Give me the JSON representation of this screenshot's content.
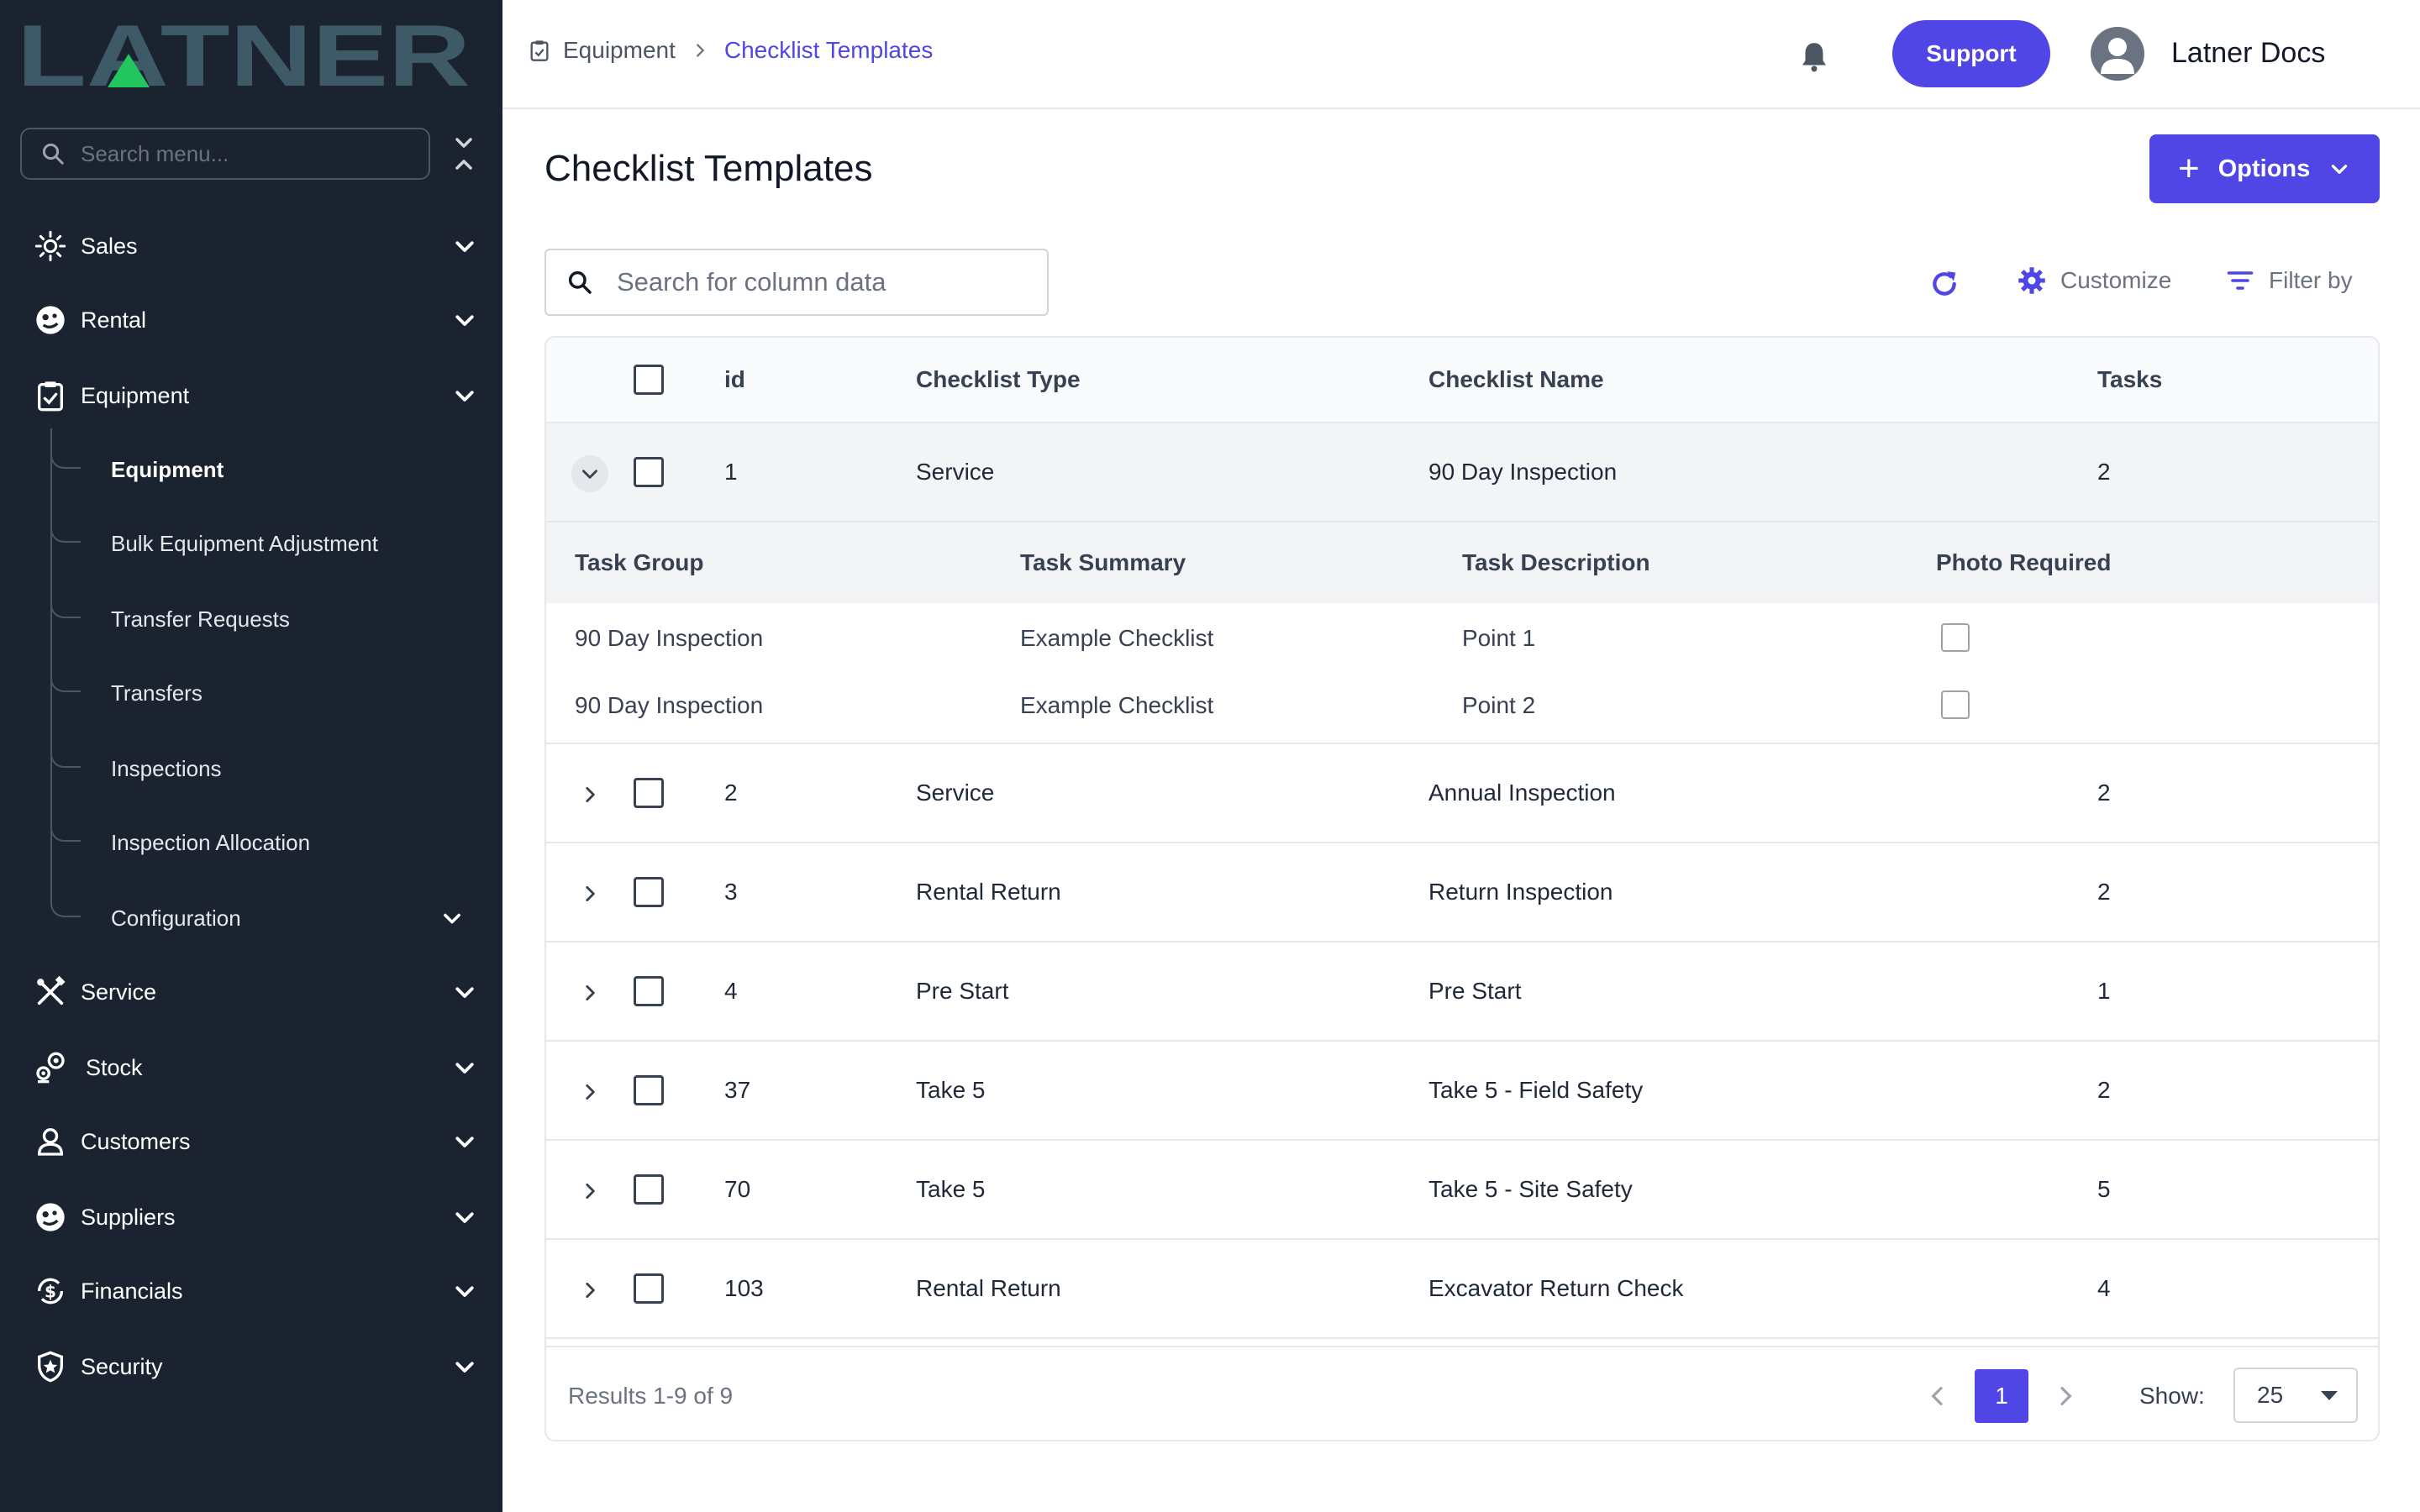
{
  "brand": {
    "logo_text": "LATNER",
    "logo_color": "#3d5a66",
    "accent_triangle": "#22c55e"
  },
  "colors": {
    "sidebar_bg": "#1b2331",
    "accent": "#4f46e5"
  },
  "sidebar": {
    "search_placeholder": "Search menu...",
    "items": [
      {
        "label": "Sales",
        "icon": "sales-icon"
      },
      {
        "label": "Rental",
        "icon": "rental-icon"
      },
      {
        "label": "Equipment",
        "icon": "clipboard-icon",
        "expanded": true
      },
      {
        "label": "Service",
        "icon": "tools-icon"
      },
      {
        "label": "Stock",
        "icon": "stock-icon"
      },
      {
        "label": "Customers",
        "icon": "person-icon"
      },
      {
        "label": "Suppliers",
        "icon": "supplier-icon"
      },
      {
        "label": "Financials",
        "icon": "dollar-cycle-icon"
      },
      {
        "label": "Security",
        "icon": "shield-icon"
      }
    ],
    "equipment_subitems": [
      {
        "label": "Equipment",
        "active": true
      },
      {
        "label": "Bulk Equipment Adjustment"
      },
      {
        "label": "Transfer Requests"
      },
      {
        "label": "Transfers"
      },
      {
        "label": "Inspections"
      },
      {
        "label": "Inspection Allocation"
      },
      {
        "label": "Configuration",
        "has_children": true
      }
    ]
  },
  "topbar": {
    "breadcrumb": [
      "Equipment",
      "Checklist Templates"
    ],
    "support_label": "Support",
    "user_name": "Latner Docs"
  },
  "page": {
    "title": "Checklist Templates",
    "options_label": "Options",
    "search_placeholder": "Search for column data",
    "customize_label": "Customize",
    "filter_label": "Filter by"
  },
  "table": {
    "columns": [
      "id",
      "Checklist Type",
      "Checklist Name",
      "Tasks"
    ],
    "rows": [
      {
        "id": "1",
        "type": "Service",
        "name": "90 Day Inspection",
        "tasks": "2",
        "expanded": true
      },
      {
        "id": "2",
        "type": "Service",
        "name": "Annual Inspection",
        "tasks": "2"
      },
      {
        "id": "3",
        "type": "Rental Return",
        "name": "Return Inspection",
        "tasks": "2"
      },
      {
        "id": "4",
        "type": "Pre Start",
        "name": "Pre Start",
        "tasks": "1"
      },
      {
        "id": "37",
        "type": "Take 5",
        "name": "Take 5 - Field Safety",
        "tasks": "2"
      },
      {
        "id": "70",
        "type": "Take 5",
        "name": "Take 5 - Site Safety",
        "tasks": "5"
      },
      {
        "id": "103",
        "type": "Rental Return",
        "name": "Excavator Return Check",
        "tasks": "4"
      }
    ],
    "subtable": {
      "columns": [
        "Task Group",
        "Task Summary",
        "Task Description",
        "Photo Required"
      ],
      "rows": [
        {
          "group": "90 Day Inspection",
          "summary": "Example Checklist",
          "description": "Point 1",
          "photo_required": false
        },
        {
          "group": "90 Day Inspection",
          "summary": "Example Checklist",
          "description": "Point 2",
          "photo_required": false
        }
      ]
    },
    "footer": {
      "results_text": "Results 1-9 of 9",
      "current_page": "1",
      "show_label": "Show:",
      "page_size": "25"
    }
  }
}
